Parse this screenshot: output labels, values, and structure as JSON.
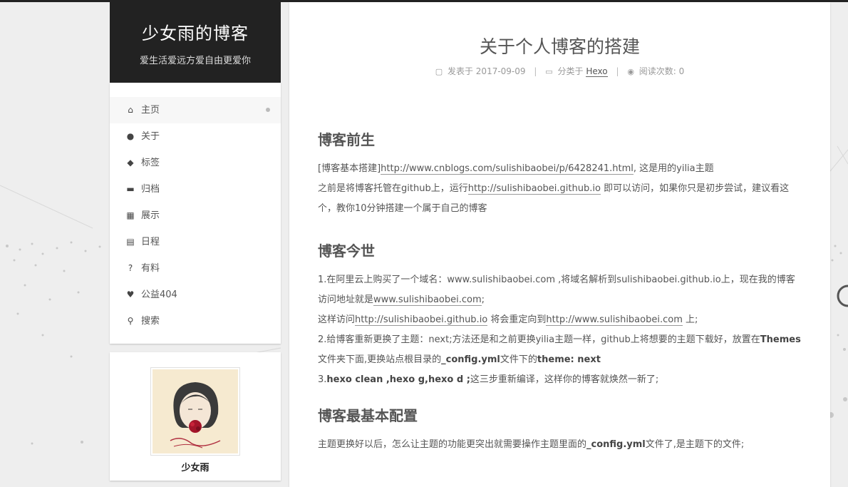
{
  "site": {
    "title": "少女雨的博客",
    "subtitle": "爱生活爱远方爱自由更爱你"
  },
  "menu": {
    "items": [
      {
        "label": "主页",
        "icon": "home-icon"
      },
      {
        "label": "关于",
        "icon": "user-icon"
      },
      {
        "label": "标签",
        "icon": "tags-icon"
      },
      {
        "label": "归档",
        "icon": "archive-icon"
      },
      {
        "label": "展示",
        "icon": "grid-icon"
      },
      {
        "label": "日程",
        "icon": "calendar-icon"
      },
      {
        "label": "有料",
        "icon": "question-icon"
      },
      {
        "label": "公益404",
        "icon": "heartbeat-icon"
      },
      {
        "label": "搜索",
        "icon": "search-icon"
      }
    ]
  },
  "author": {
    "name": "少女雨"
  },
  "post": {
    "title": "关于个人博客的搭建",
    "meta": {
      "posted_label": "发表于",
      "date": "2017-09-09",
      "category_label": "分类于",
      "category": "Hexo",
      "views_label": "阅读次数:",
      "views": "0"
    },
    "sections": {
      "s1": {
        "heading": "博客前生",
        "l1a": "[博客基本搭建]",
        "l1link": "http://www.cnblogs.com/sulishibaobei/p/6428241.html",
        "l1b": ", 这是用的yilia主题",
        "l2a": "之前是将博客托管在github上，运行",
        "l2link": "http://sulishibaobei.github.io",
        "l2b": " 即可以访问，如果你只是初步尝试，建议看这个，教你10分钟搭建一个属于自己的博客"
      },
      "s2": {
        "heading": "博客今世",
        "l1": "1.在阿里云上购买了一个域名：www.sulishibaobei.com ,将域名解析到sulishibaobei.github.io上，现在我的博客访问地址就是",
        "l1link": "www.sulishibaobei.com",
        "l1end": ";",
        "l2a": "这样访问",
        "l2link1": "http://sulishibaobei.github.io",
        "l2b": " 将会重定向到",
        "l2link2": "http://www.sulishibaobei.com",
        "l2c": " 上;",
        "l3a": "2.给博客重新更换了主题：next;方法还是和之前更换yilia主题一样，github上将想要的主题下载好，放置在",
        "l3b1": "Themes",
        "l3c": "文件夹下面,更换站点根目录的",
        "l3b2": "_config.yml",
        "l3d": "文件下的",
        "l3b3": "theme: next",
        "l4a": "3.",
        "l4b": "hexo clean ,hexo g,hexo d ;",
        "l4c": "这三步重新编译，这样你的博客就焕然一新了;"
      },
      "s3": {
        "heading": "博客最基本配置",
        "l1a": "主题更换好以后，怎么让主题的功能更突出就需要操作主题里面的",
        "l1b": "_config.yml",
        "l1c": "文件了,是主题下的文件;"
      }
    }
  }
}
